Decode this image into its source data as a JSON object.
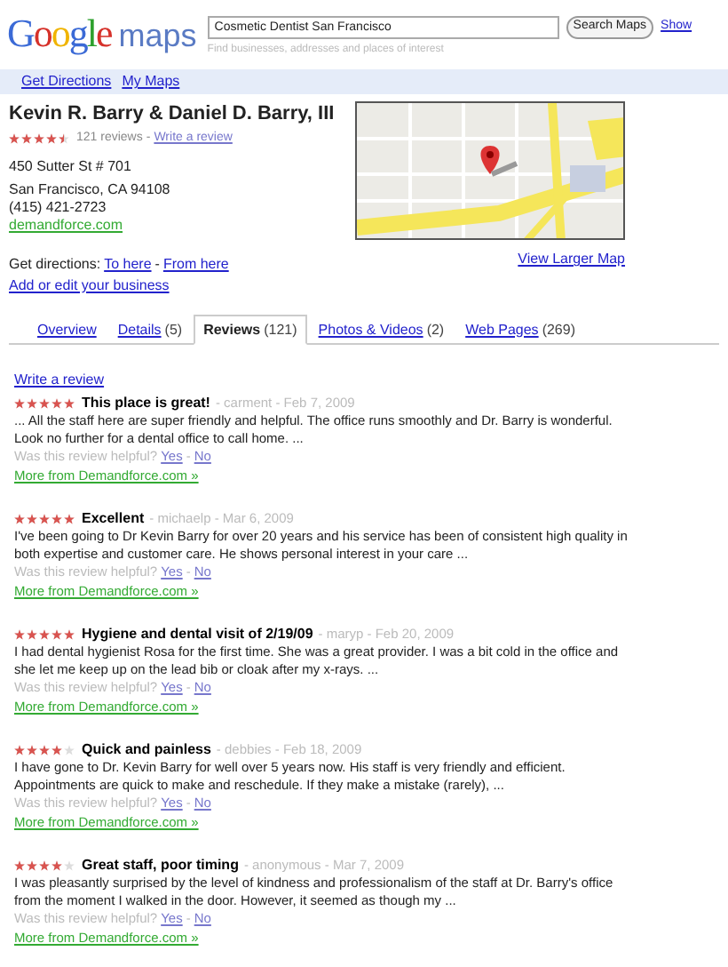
{
  "header": {
    "logo": [
      "G",
      "o",
      "o",
      "g",
      "l",
      "e"
    ],
    "product": "maps",
    "search": {
      "value": "Cosmetic Dentist San Francisco",
      "hint": "Find businesses, addresses and places of interest"
    },
    "search_button": "Search Maps",
    "extra_link": "Show"
  },
  "nav_links": [
    "Get Directions",
    "My Maps"
  ],
  "business": {
    "name": "Kevin R. Barry & Daniel D. Barry, III",
    "stars": 4.5,
    "review_count": "121 reviews",
    "review_sep": "-",
    "write_review": "Write a review",
    "address": [
      "450 Sutter St # 701",
      "San Francisco, CA 94108"
    ],
    "phone": "(415) 421-2723",
    "website": "demandforce.com",
    "directions_label": "Get directions:",
    "to_here": "To here",
    "directions_sep": "-",
    "from_here": "From here",
    "edit_link": "Add or edit your business",
    "larger_map": "View Larger Map"
  },
  "tabs": [
    {
      "label": "Overview",
      "selected": false
    },
    {
      "label": "Details",
      "count": "(5)",
      "selected": false
    },
    {
      "label": "Reviews",
      "count": "(121)",
      "selected": true
    },
    {
      "label": "Photos & Videos",
      "count": "(2)",
      "selected": false
    },
    {
      "label": "Web Pages",
      "count": "(269)",
      "selected": false
    }
  ],
  "write_review": "Write a review",
  "reviews": [
    {
      "stars": 5,
      "title": "This place is great!",
      "byline": "- carment - Feb 7, 2009",
      "vote_sep": "-",
      "body": "... All the staff here are super friendly and helpful. The office runs smoothly and Dr. Barry is wonderful. Look no further for a dental office to call home. ...",
      "helpful": "Was this review helpful?",
      "yes": "Yes",
      "no": "No",
      "more": "More from Demandforce.com »"
    },
    {
      "stars": 5,
      "title": "Excellent",
      "byline": "- michaelp - Mar 6, 2009",
      "vote_sep": "-",
      "body": "I've been going to Dr Kevin Barry for over 20 years and his service has been of consistent high quality in both expertise and customer care. He shows personal interest in your care ...",
      "helpful": "Was this review helpful?",
      "yes": "Yes",
      "no": "No",
      "more": "More from Demandforce.com »"
    },
    {
      "stars": 5,
      "title": "Hygiene and dental visit of 2/19/09",
      "byline": "- maryp - Feb 20, 2009",
      "vote_sep": "-",
      "body": "I had dental hygienist Rosa for the first time. She was a great provider. I was a bit cold in the office and she let me keep up on the lead bib or cloak after my x-rays. ...",
      "helpful": "Was this review helpful?",
      "yes": "Yes",
      "no": "No",
      "more": "More from Demandforce.com »"
    },
    {
      "stars": 4,
      "title": "Quick and painless",
      "byline": "- debbies - Feb 18, 2009",
      "vote_sep": "-",
      "body": "I have gone to Dr. Kevin Barry for well over 5 years now. His staff is very friendly and efficient. Appointments are quick to make and reschedule. If they make a mistake (rarely), ...",
      "helpful": "Was this review helpful?",
      "yes": "Yes",
      "no": "No",
      "more": "More from Demandforce.com »"
    },
    {
      "stars": 4,
      "title": "Great staff, poor timing",
      "byline": "- anonymous - Mar 7, 2009",
      "vote_sep": "-",
      "body": "I was pleasantly surprised by the level of kindness and professionalism of the staff at Dr. Barry's office from the moment I walked in the door. However, it seemed as though my ...",
      "helpful": "Was this review helpful?",
      "yes": "Yes",
      "no": "No",
      "more": "More from Demandforce.com »"
    }
  ]
}
